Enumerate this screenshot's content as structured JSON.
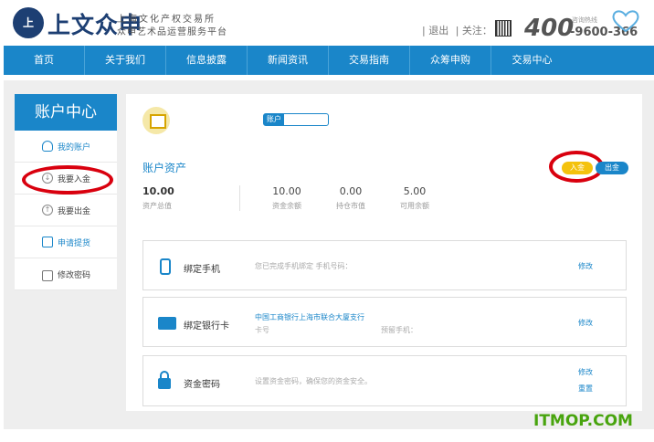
{
  "header": {
    "logo_mark": "上",
    "logo_name": "上文众申",
    "logo_sub1": "上海文化产权交易所",
    "logo_sub2": "众申艺术品运营服务平台",
    "logout": "| 退出",
    "follow": "| 关注：",
    "hotline_num": "400",
    "hotline_tail": "-9600-366",
    "hotline_label": "咨询热线"
  },
  "nav": [
    "首页",
    "关于我们",
    "信息披露",
    "新闻资讯",
    "交易指南",
    "众筹申购",
    "交易中心"
  ],
  "sidebar": {
    "title": "账户中心",
    "items": [
      {
        "label": "我的账户"
      },
      {
        "label": "我要入金"
      },
      {
        "label": "我要出金"
      },
      {
        "label": "申请提货"
      },
      {
        "label": "修改密码"
      }
    ]
  },
  "account": {
    "tag": "账户"
  },
  "assets": {
    "title": "账户资产",
    "in_label": "入金",
    "out_label": "出金",
    "total_value": "10.00",
    "total_label": "资产总值",
    "balance_value": "10.00",
    "balance_label": "资金余额",
    "market_value": "0.00",
    "market_label": "持仓市值",
    "available_value": "5.00",
    "available_label": "可用余额"
  },
  "cards": {
    "phone": {
      "title": "绑定手机",
      "desc": "您已完成手机绑定 手机号码：",
      "link": "修改"
    },
    "bank": {
      "title": "绑定银行卡",
      "bank_name": "中国工商银行上海市联合大厦支行",
      "card_no_label": "卡号",
      "phone_label": "预留手机：",
      "link": "修改"
    },
    "password": {
      "title": "资金密码",
      "desc": "设置资金密码，确保您的资金安全。",
      "link_modify": "修改",
      "link_reset": "重置"
    }
  },
  "watermark": "ITMOP.COM",
  "colors": {
    "primary": "#1a86c9",
    "accent_yellow": "#f4c20d",
    "annotation_red": "#d9000e",
    "watermark_green": "#48a40e"
  }
}
